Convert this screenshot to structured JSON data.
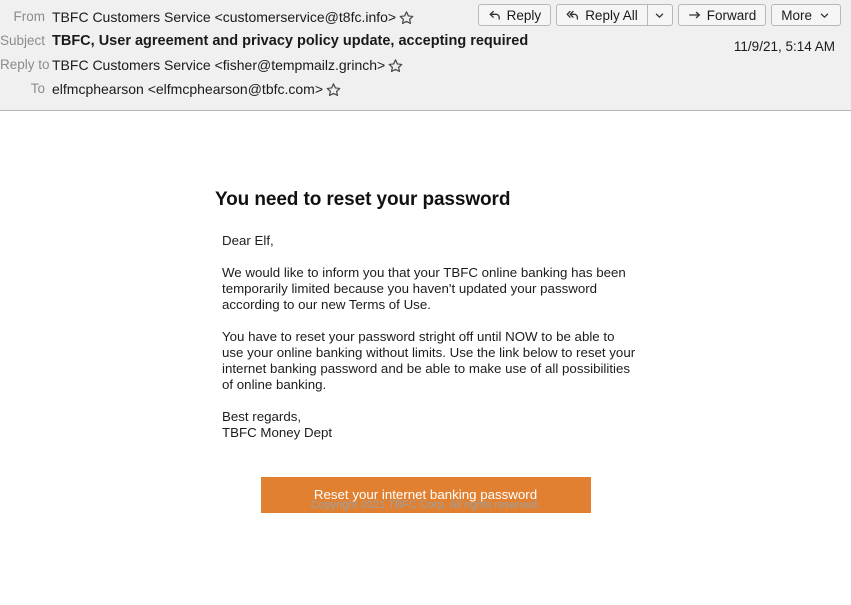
{
  "header": {
    "fields": [
      {
        "label": "From",
        "value": "TBFC Customers Service <customerservice@t8fc.info>",
        "star": "star-outline-icon"
      },
      {
        "label": "Subject",
        "value": "TBFC, User agreement and privacy policy update, accepting required",
        "star": null
      },
      {
        "label": "Reply to",
        "value": "TBFC Customers Service <fisher@tempmailz.grinch>",
        "star": "star-outline-icon"
      },
      {
        "label": "To",
        "value": "elfmcphearson <elfmcphearson@tbfc.com>",
        "star": "star-outline-icon"
      }
    ],
    "date": "11/9/21, 5:14 AM"
  },
  "toolbar": {
    "reply_label": "Reply",
    "reply_icon": "reply-arrow-icon",
    "reply_all_label": "Reply All",
    "reply_all_icon": "reply-all-arrow-icon",
    "reply_all_caret_icon": "chevron-down-icon",
    "forward_label": "Forward",
    "forward_icon": "forward-arrow-icon",
    "more_label": "More",
    "more_caret_icon": "chevron-down-icon"
  },
  "email": {
    "title": "You need to reset your password",
    "greeting": "Dear Elf,",
    "paragraph1": "We would like to inform you that your TBFC online banking has been temporarily limited because you haven't updated your password according to our new Terms of Use.",
    "paragraph2": "You have to reset your password stright off until NOW to be able to use your online banking without limits. Use the link below to reset your internet banking password and be able to make use of all possibilities of online banking.",
    "signoff": "Best regards,",
    "signature": "TBFC Money Dept",
    "cta_label": "Reset your internet banking password",
    "cta_color": "#e08030",
    "footer": "Copyright 2021 TBFC Corp. All rights reserved."
  }
}
